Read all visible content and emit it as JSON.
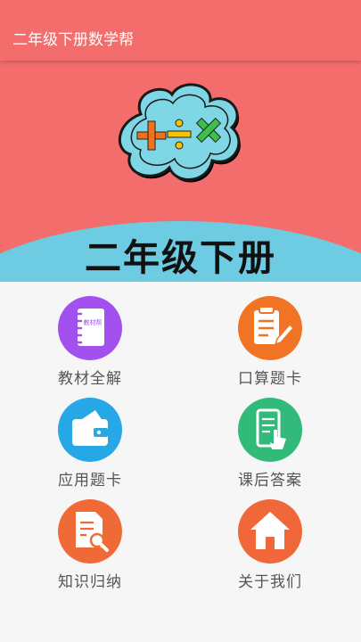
{
  "app": {
    "title": "二年级下册数学帮"
  },
  "banner": {
    "title": "二年级下册",
    "icon": "math-symbols-cloud"
  },
  "menu": [
    {
      "label": "教材全解",
      "icon": "notebook-icon",
      "color": "#a351ee"
    },
    {
      "label": "口算题卡",
      "icon": "document-edit-icon",
      "color": "#f07423"
    },
    {
      "label": "应用题卡",
      "icon": "wallet-icon",
      "color": "#26a7e6"
    },
    {
      "label": "课后答案",
      "icon": "phone-tap-icon",
      "color": "#32ba7a"
    },
    {
      "label": "知识归纳",
      "icon": "document-search-icon",
      "color": "#f06a38"
    },
    {
      "label": "关于我们",
      "icon": "home-icon",
      "color": "#f0683a"
    }
  ],
  "notebook_text": "教材帮"
}
